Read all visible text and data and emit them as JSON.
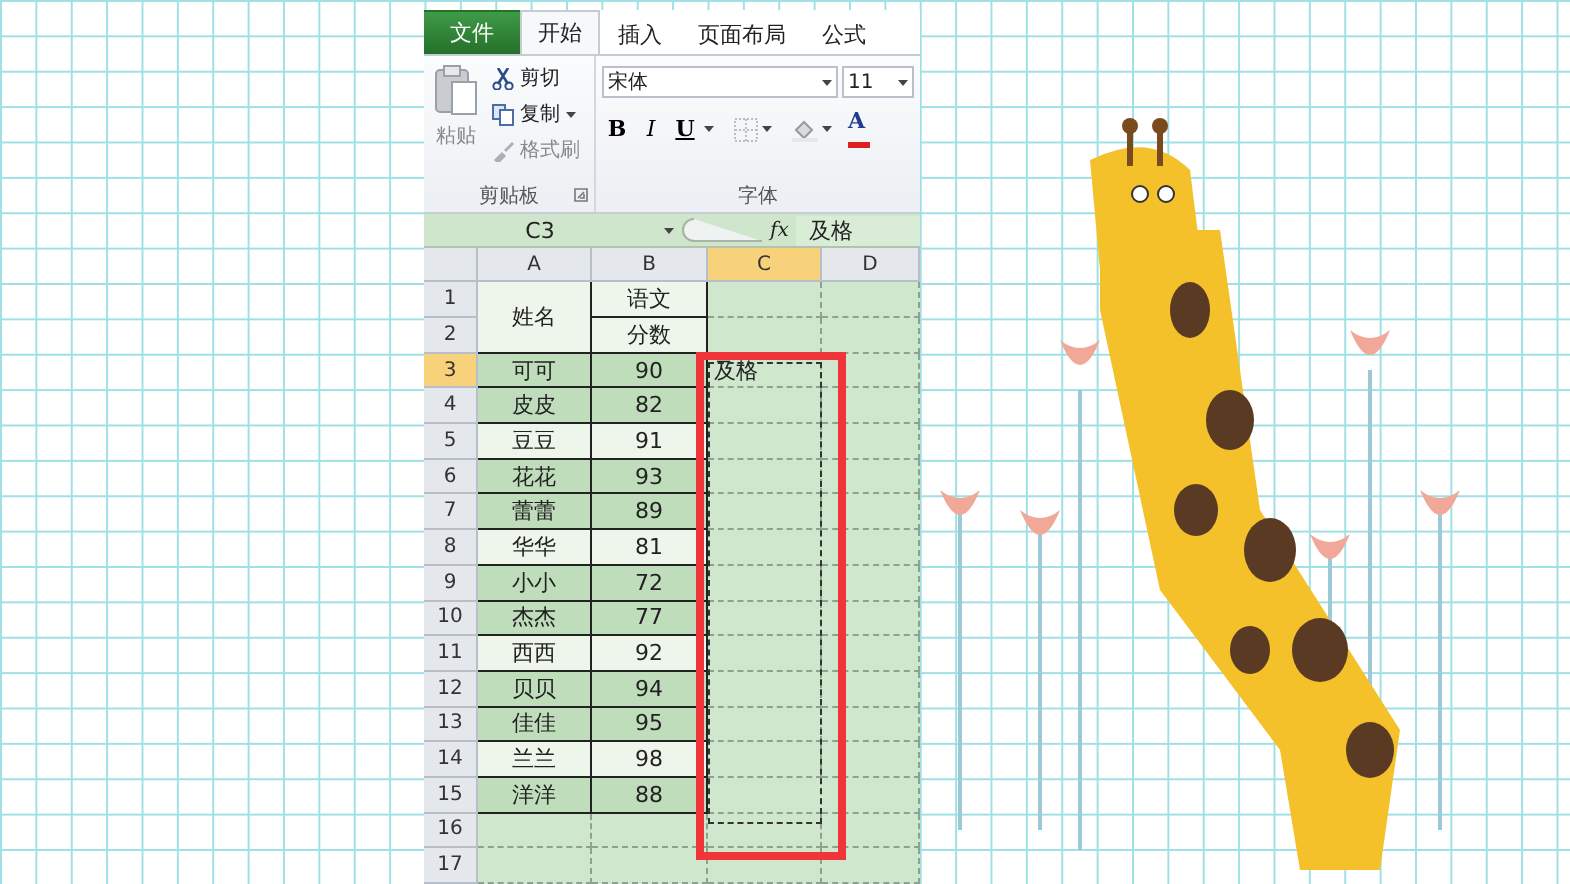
{
  "ribbon_tabs": [
    {
      "label": "文件",
      "kind": "file",
      "selected": false
    },
    {
      "label": "开始",
      "kind": "tab",
      "selected": true
    },
    {
      "label": "插入",
      "kind": "tab",
      "selected": false
    },
    {
      "label": "页面布局",
      "kind": "tab",
      "selected": false
    },
    {
      "label": "公式",
      "kind": "tab",
      "selected": false
    }
  ],
  "clipboard_group": {
    "paste": "粘贴",
    "cut": "剪切",
    "copy": "复制",
    "format_painter": "格式刷",
    "label": "剪贴板"
  },
  "font_group": {
    "font_name": "宋体",
    "font_size": "11",
    "bold": "B",
    "italic": "I",
    "underline": "U",
    "font_color": "A",
    "label": "字体"
  },
  "formula_bar": {
    "name_box": "C3",
    "fx": "fx",
    "content": "及格"
  },
  "sheet": {
    "columns": [
      {
        "label": "A",
        "selected": false
      },
      {
        "label": "B",
        "selected": false
      },
      {
        "label": "C",
        "selected": true
      },
      {
        "label": "D",
        "selected": false
      }
    ],
    "rows": [
      {
        "number": "1",
        "selected": false,
        "shaded": true,
        "a_merged_down": true,
        "cells": {
          "A": "姓名",
          "B": "语文"
        }
      },
      {
        "number": "2",
        "selected": false,
        "shaded": true,
        "cells": {
          "B": "分数"
        }
      },
      {
        "number": "3",
        "selected": true,
        "shaded": false,
        "cells": {
          "A": "可可",
          "B": "90",
          "C": "及格"
        }
      },
      {
        "number": "4",
        "selected": false,
        "shaded": false,
        "cells": {
          "A": "皮皮",
          "B": "82"
        }
      },
      {
        "number": "5",
        "selected": false,
        "shaded": true,
        "cells": {
          "A": "豆豆",
          "B": "91"
        }
      },
      {
        "number": "6",
        "selected": false,
        "shaded": false,
        "cells": {
          "A": "花花",
          "B": "93"
        }
      },
      {
        "number": "7",
        "selected": false,
        "shaded": false,
        "cells": {
          "A": "蕾蕾",
          "B": "89"
        }
      },
      {
        "number": "8",
        "selected": false,
        "shaded": true,
        "cells": {
          "A": "华华",
          "B": "81"
        }
      },
      {
        "number": "9",
        "selected": false,
        "shaded": false,
        "cells": {
          "A": "小小",
          "B": "72"
        }
      },
      {
        "number": "10",
        "selected": false,
        "shaded": false,
        "cells": {
          "A": "杰杰",
          "B": "77"
        }
      },
      {
        "number": "11",
        "selected": false,
        "shaded": true,
        "cells": {
          "A": "西西",
          "B": "92"
        }
      },
      {
        "number": "12",
        "selected": false,
        "shaded": false,
        "cells": {
          "A": "贝贝",
          "B": "94"
        }
      },
      {
        "number": "13",
        "selected": false,
        "shaded": false,
        "cells": {
          "A": "佳佳",
          "B": "95"
        }
      },
      {
        "number": "14",
        "selected": false,
        "shaded": true,
        "cells": {
          "A": "兰兰",
          "B": "98"
        }
      },
      {
        "number": "15",
        "selected": false,
        "shaded": false,
        "cells": {
          "A": "洋洋",
          "B": "88"
        }
      },
      {
        "number": "16",
        "selected": false,
        "cells": {}
      },
      {
        "number": "17",
        "selected": false,
        "cells": {}
      }
    ]
  }
}
